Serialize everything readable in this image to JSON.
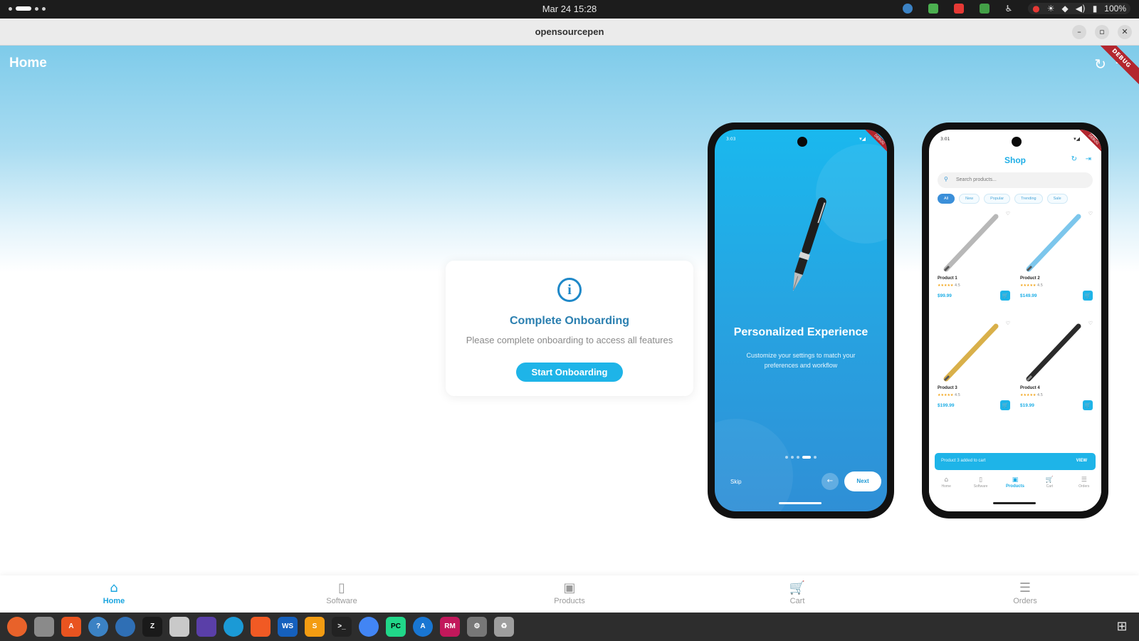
{
  "system_bar": {
    "clock": "Mar 24  15:28",
    "battery": "100%"
  },
  "window": {
    "title": "opensourcepen",
    "minimize": "–",
    "maximize": "▫",
    "close": "✕"
  },
  "app_bar": {
    "title": "Home",
    "debug_banner": "DEBUG"
  },
  "onboarding_card": {
    "icon": "i",
    "title": "Complete Onboarding",
    "subtitle": "Please complete onboarding to access all features",
    "button_label": "Start Onboarding"
  },
  "phone_onboarding": {
    "status_time": "3:03",
    "title": "Personalized Experience",
    "description": "Customize your settings to match your preferences and workflow",
    "skip_label": "Skip",
    "next_label": "Next",
    "page_count": 5,
    "active_page": 3
  },
  "phone_shop": {
    "status_time": "3:01",
    "title": "Shop",
    "search_placeholder": "Search products...",
    "chips": [
      {
        "label": "All",
        "active": true
      },
      {
        "label": "New",
        "active": false
      },
      {
        "label": "Popular",
        "active": false
      },
      {
        "label": "Trending",
        "active": false
      },
      {
        "label": "Sale",
        "active": false
      }
    ],
    "products": [
      {
        "name": "Product 1",
        "rating": "4.5",
        "price": "$99.99",
        "color": "#b8b8b8"
      },
      {
        "name": "Product 2",
        "rating": "4.5",
        "price": "$149.99",
        "color": "#7cc6ec"
      },
      {
        "name": "Product 3",
        "rating": "4.5",
        "price": "$199.99",
        "color": "#d9b04a"
      },
      {
        "name": "Product 4",
        "rating": "4.5",
        "price": "$19.99",
        "color": "#2a2a2a"
      }
    ],
    "snackbar_text": "Product 3 added to cart",
    "snackbar_action": "VIEW",
    "nav": [
      "Home",
      "Software",
      "Products",
      "Cart",
      "Orders"
    ],
    "nav_active": "Products"
  },
  "bottom_nav": {
    "items": [
      {
        "label": "Home",
        "icon": "home-icon",
        "active": true
      },
      {
        "label": "Software",
        "icon": "software-icon",
        "active": false
      },
      {
        "label": "Products",
        "icon": "shopping-bag-icon",
        "active": false
      },
      {
        "label": "Cart",
        "icon": "cart-icon",
        "active": false
      },
      {
        "label": "Orders",
        "icon": "orders-icon",
        "active": false
      }
    ]
  },
  "colors": {
    "accent": "#1eb4e8",
    "title_blue": "#2a7fb0",
    "debug_red": "#b3262e"
  }
}
